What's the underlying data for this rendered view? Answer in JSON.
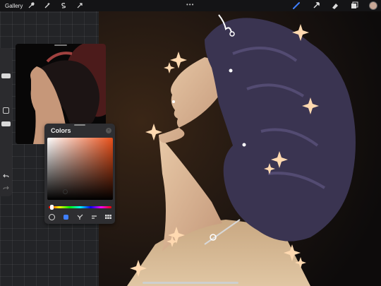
{
  "toolbar": {
    "gallery_label": "Gallery",
    "left_tools": [
      "wrench-icon",
      "magic-wand-icon",
      "selection-icon",
      "transform-icon"
    ],
    "right_tools": [
      "brush-icon",
      "smudge-icon",
      "eraser-icon",
      "layers-icon",
      "color-swatch"
    ],
    "active_tool": "brush-icon",
    "more_label": "•••"
  },
  "colors_panel": {
    "title": "Colors",
    "hue_color": "#e8501a",
    "current_color": "#c9a896",
    "tabs": [
      "disc",
      "classic",
      "harmony",
      "value",
      "palettes"
    ],
    "active_tab": "classic"
  },
  "accent": "#3f7fff"
}
